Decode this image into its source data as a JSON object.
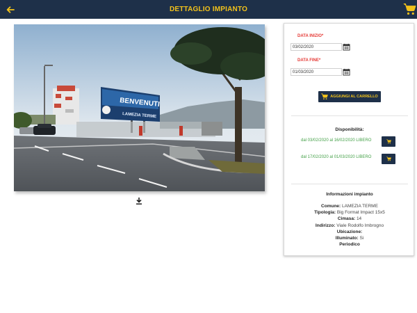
{
  "header": {
    "title": "DETTAGLIO IMPIANTO",
    "back_icon": "arrow-left-icon",
    "cart_icon": "shopping-cart-icon",
    "accent_color": "#f2c21b",
    "bar_color": "#1e3049"
  },
  "photo": {
    "billboard_headline": "BENVENUTI",
    "billboard_subtitle": "LAMEZIA TERME",
    "download_icon": "download-icon"
  },
  "booking": {
    "start_label": "DATA INIZIO*",
    "start_value": "03/02/2020",
    "end_label": "DATA FINE*",
    "end_value": "01/03/2020",
    "add_to_cart_label": "AGGIUNGI AL CARRELLO"
  },
  "availability": {
    "title": "Disponibilità:",
    "slots": [
      {
        "text": "dal 03/02/2020 al 16/02/2020 LIBERO"
      },
      {
        "text": "dal 17/02/2020 al 01/03/2020 LIBERO"
      }
    ]
  },
  "info": {
    "title": "Informazioni impianto",
    "rows": [
      {
        "label": "Comune:",
        "value": "LAMEZIA TERME"
      },
      {
        "label": "Tipologia:",
        "value": "Big Format Impact 15x5"
      },
      {
        "label": "Cimasa:",
        "value": "14"
      },
      {
        "label": "Indirizzo:",
        "value": "Viale Rodolfo Imbrogno"
      },
      {
        "label": "Ubicazione:",
        "value": ""
      },
      {
        "label": "Illuminato:",
        "value": "Si"
      },
      {
        "label": "Periodico",
        "value": ""
      }
    ]
  }
}
